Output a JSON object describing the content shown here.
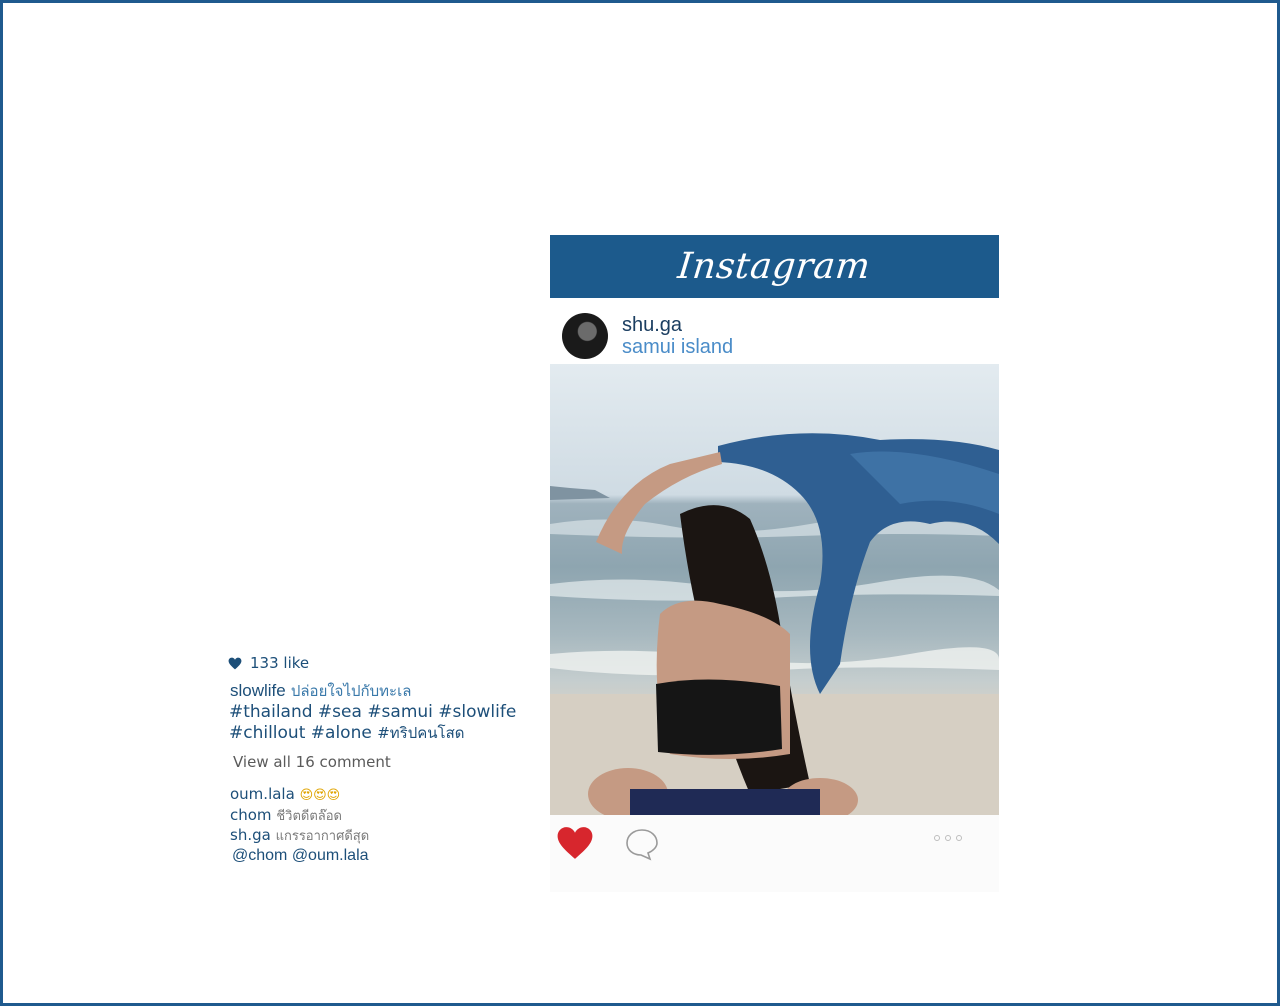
{
  "post": {
    "brand": "Instagram",
    "username": "shu.ga",
    "location": "samui island"
  },
  "caption": {
    "likes": "133 like",
    "author": "slowlife",
    "author_text": "ปล่อยใจไปกับทะเล",
    "tags_line1": "#thailand #sea #samui #slowlife",
    "tags_line2": "#chillout #alone",
    "tags_line2_thai": "#ทริปคนโสด",
    "view_all": "View all 16 comment"
  },
  "comments": [
    {
      "user": "oum.lala",
      "text": "😍😍😍"
    },
    {
      "user": "chom",
      "text": "ชีวิตดีตล๊อด"
    },
    {
      "user": "sh.ga",
      "text": "แกรรอากาศดีสุด"
    }
  ],
  "mentions": "@chom @oum.lala",
  "colors": {
    "brand_blue": "#1c5a8c",
    "text_blue": "#1d4f79",
    "location_blue": "#4a8cc8",
    "heart_red": "#d7262d"
  },
  "icons": [
    "heart-icon",
    "comment-icon",
    "more-icon"
  ]
}
